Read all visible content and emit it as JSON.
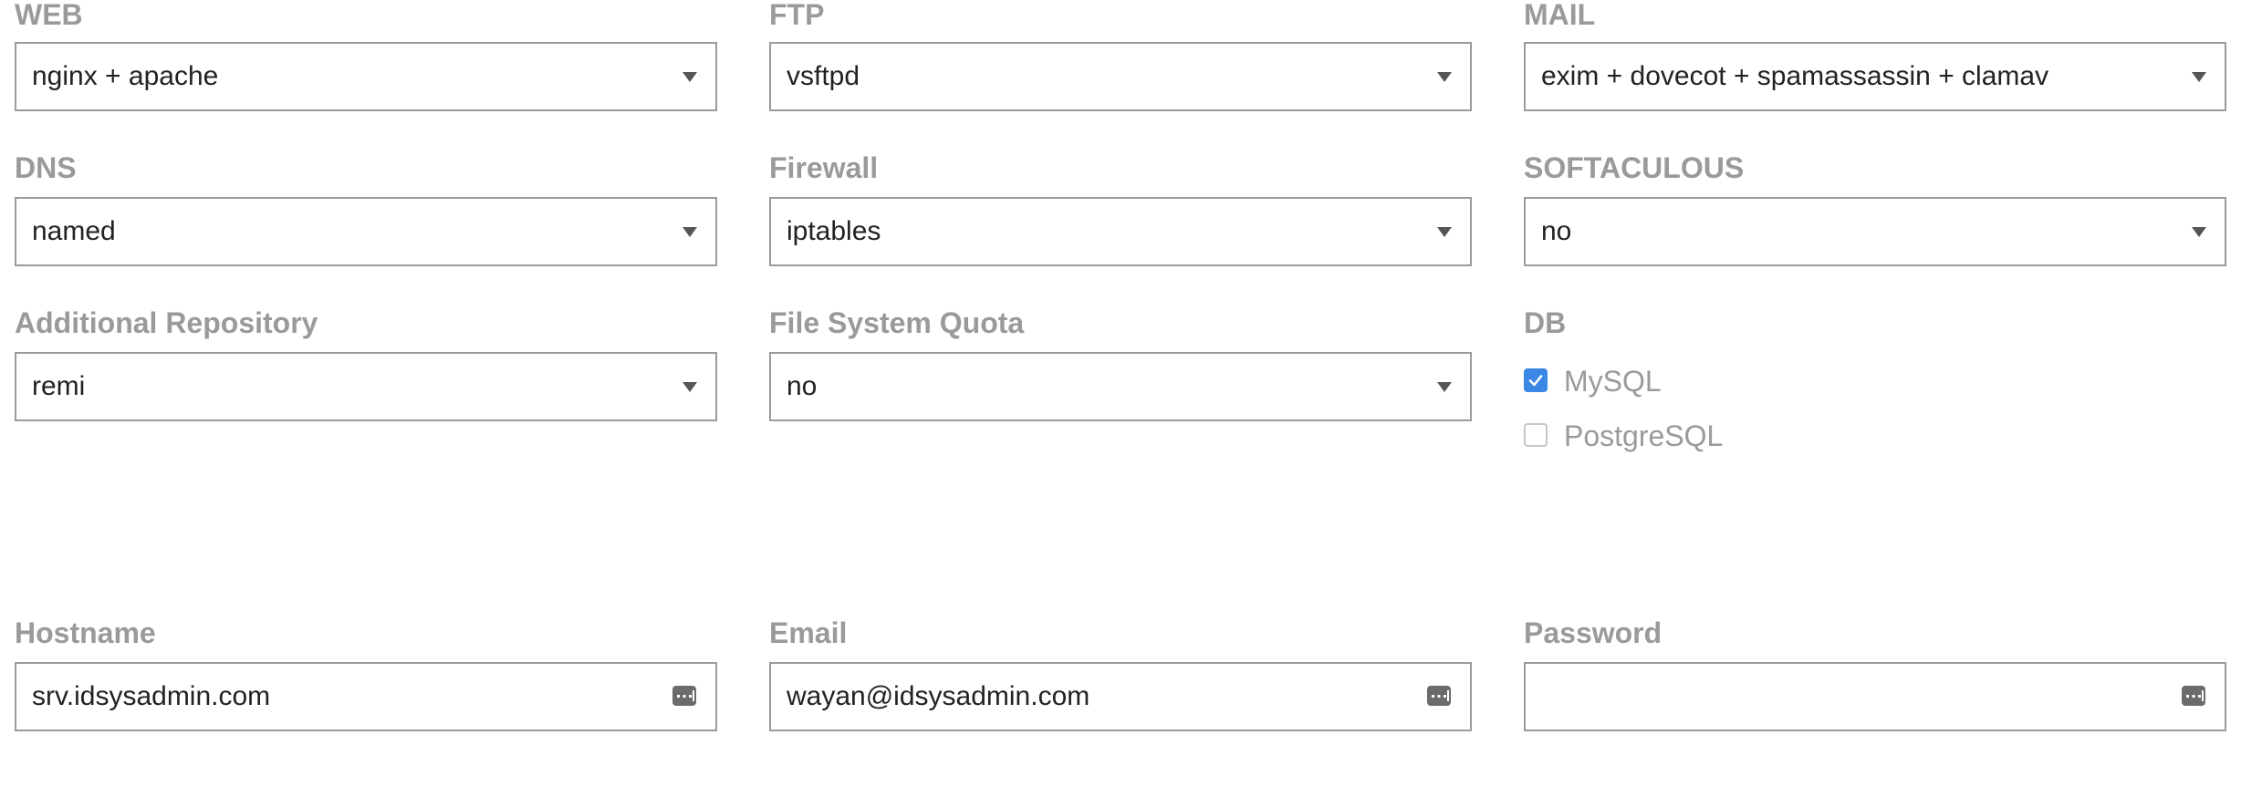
{
  "selects": {
    "web": {
      "label": "WEB",
      "value": "nginx + apache"
    },
    "ftp": {
      "label": "FTP",
      "value": "vsftpd"
    },
    "mail": {
      "label": "MAIL",
      "value": "exim + dovecot + spamassassin + clamav"
    },
    "dns": {
      "label": "DNS",
      "value": "named"
    },
    "firewall": {
      "label": "Firewall",
      "value": "iptables"
    },
    "softaculous": {
      "label": "SOFTACULOUS",
      "value": "no"
    },
    "repository": {
      "label": "Additional Repository",
      "value": "remi"
    },
    "quota": {
      "label": "File System Quota",
      "value": "no"
    }
  },
  "db": {
    "label": "DB",
    "options": [
      {
        "label": "MySQL",
        "checked": true
      },
      {
        "label": "PostgreSQL",
        "checked": false
      }
    ]
  },
  "inputs": {
    "hostname": {
      "label": "Hostname",
      "value": "srv.idsysadmin.com"
    },
    "email": {
      "label": "Email",
      "value": "wayan@idsysadmin.com"
    },
    "password": {
      "label": "Password",
      "value": ""
    }
  },
  "icons": {
    "select_caret": "caret-down-icon",
    "input_helper": "keyboard-icon",
    "checkbox_check": "check-icon"
  },
  "colors": {
    "label": "#9a9a9a",
    "border": "#9b9b9b",
    "text": "#222222",
    "checkbox_on": "#3a87e6"
  }
}
